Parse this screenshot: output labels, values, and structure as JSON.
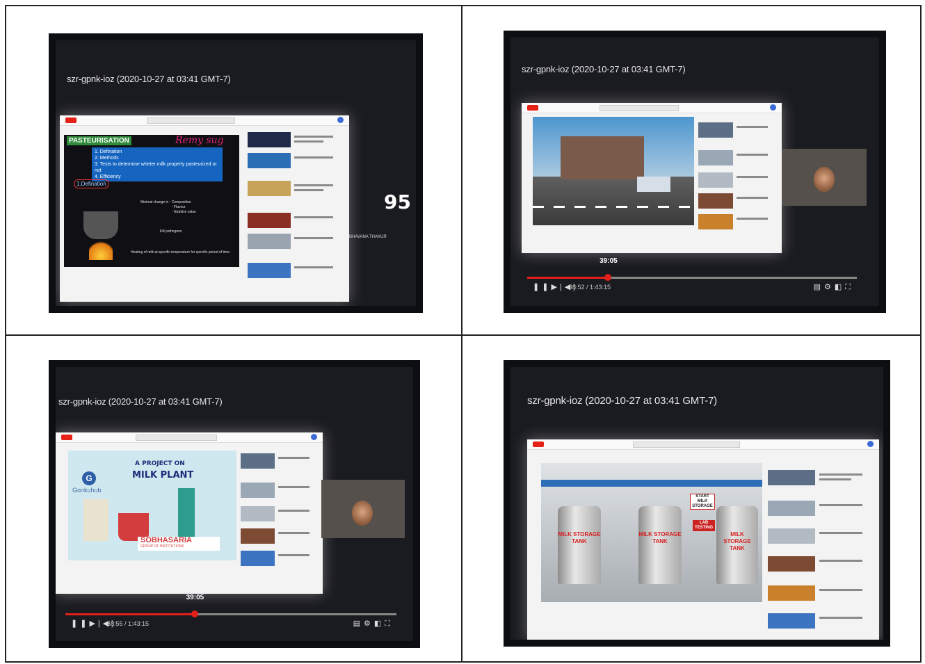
{
  "meeting_label": "szr-gpnk-ioz (2020-10-27 at 03:41 GMT-7)",
  "panels": [
    {
      "slide": {
        "title": "PASTEURISATION",
        "items": [
          "1. Defination",
          "2. Methods",
          "3. Tests to determine wheter milk properly pasteurized or not",
          "4. Efficiency"
        ],
        "highlight": "1.Defination",
        "handwriting": "Remy sug",
        "notes": [
          "Minimal change in - Composition",
          "- Flavour",
          "- Nutritive value",
          "Kill pathogens",
          "Heating of milk at specific temperature for specific period of time"
        ]
      },
      "badge": "95",
      "participant_name": "BHAVANA THAKUR"
    },
    {
      "progress_fraction": 0.245,
      "tooltip": "39:05",
      "time": "38:52 / 1:43:15"
    },
    {
      "banner_small": "A PROJECT ON",
      "banner_big": "MILK PLANT",
      "logo_letter": "G",
      "logo_text": "Gonkuhub",
      "sponsor": "SOBHASARIA",
      "sponsor_sub": "GROUP OF INSTITUTIONS",
      "progress_fraction": 0.39,
      "tooltip": "39:05",
      "time": "38:55 / 1:43:15"
    },
    {
      "tanks": [
        "MILK STORAGE TANK",
        "MILK STORAGE TANK",
        "MILK STORAGE TANK"
      ],
      "sign_top": "START MILK STORAGE",
      "sign_lab": "LAB TESTING"
    }
  ]
}
